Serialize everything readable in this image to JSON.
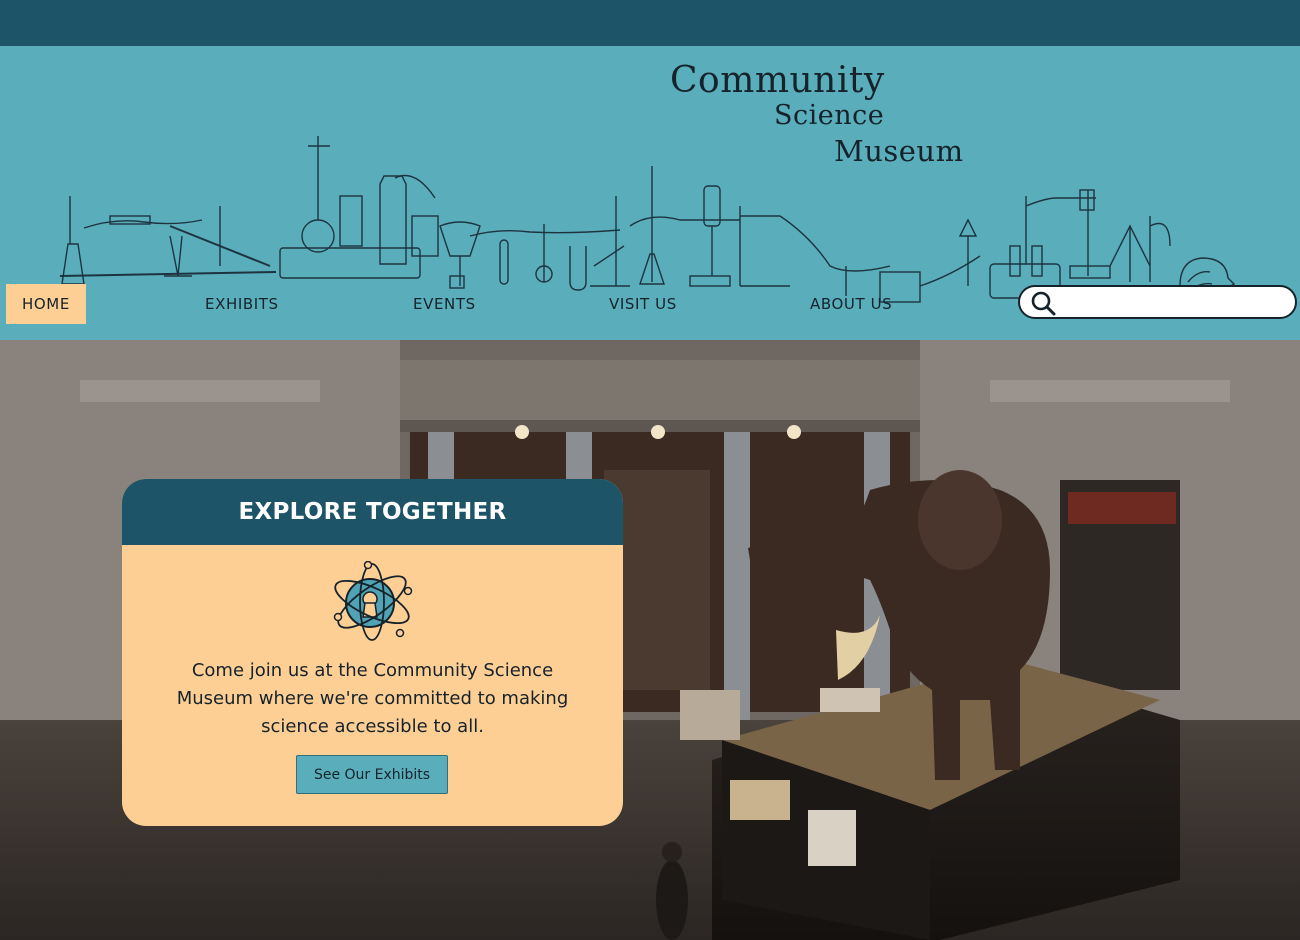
{
  "logo": {
    "line1": "Community",
    "line2": "Science",
    "line3": "Museum"
  },
  "nav": {
    "items": [
      {
        "label": "HOME",
        "active": true
      },
      {
        "label": "EXHIBITS",
        "active": false
      },
      {
        "label": "EVENTS",
        "active": false
      },
      {
        "label": "VISIT US",
        "active": false
      },
      {
        "label": "ABOUT US",
        "active": false
      }
    ]
  },
  "search": {
    "value": "",
    "placeholder": "",
    "icon": "magnifier-icon"
  },
  "hero": {
    "scene": "museum rotunda with elephant exhibit",
    "card": {
      "title": "EXPLORE TOGETHER",
      "icon": "atom-icon",
      "body": "Come join us at the Community Science Museum where we're committed to making science accessible to all.",
      "button_label": "See Our Exhibits"
    }
  },
  "colors": {
    "dark_teal": "#1d5467",
    "teal": "#5aaebb",
    "peach": "#fdcf95",
    "ink": "#16232a"
  }
}
